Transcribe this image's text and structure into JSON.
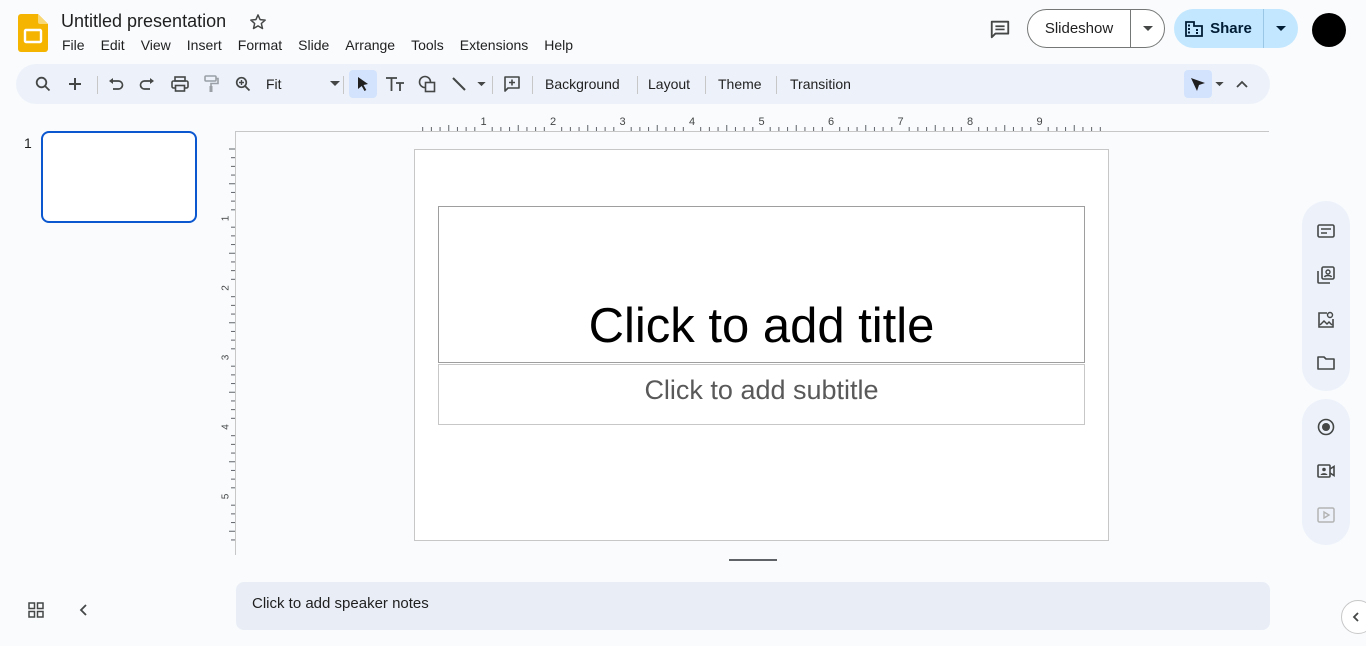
{
  "app": {
    "name": "Google Slides",
    "logo_icon": "slides-logo-icon",
    "accent": "#f4b400"
  },
  "document": {
    "title": "Untitled presentation"
  },
  "menu": [
    "File",
    "Edit",
    "View",
    "Insert",
    "Format",
    "Slide",
    "Arrange",
    "Tools",
    "Extensions",
    "Help"
  ],
  "header": {
    "slideshow_label": "Slideshow",
    "share_label": "Share"
  },
  "toolbar": {
    "zoom_value": "Fit",
    "background_label": "Background",
    "layout_label": "Layout",
    "theme_label": "Theme",
    "transition_label": "Transition"
  },
  "filmstrip": {
    "slide_number": "1"
  },
  "ruler": {
    "horizontal": [
      "1",
      "2",
      "3",
      "4",
      "5",
      "6",
      "7",
      "8",
      "9"
    ],
    "vertical": [
      "1",
      "2",
      "3",
      "4",
      "5"
    ]
  },
  "slide": {
    "title_placeholder": "Click to add title",
    "subtitle_placeholder": "Click to add subtitle"
  },
  "notes": {
    "placeholder": "Click to add speaker notes"
  },
  "colors": {
    "share_bg": "#c2e7ff",
    "selection": "#0b57d0",
    "toolbar_bg": "#edf2fa"
  }
}
